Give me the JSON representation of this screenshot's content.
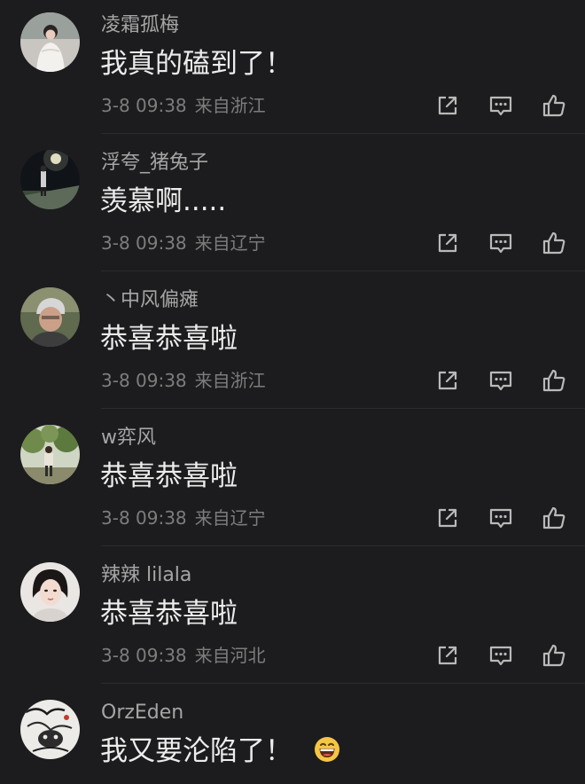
{
  "colors": {
    "background": "#1c1c1e",
    "username": "#a5a5a5",
    "comment_text": "#ececec",
    "meta": "#7d7d7d",
    "icon": "#b9b9b9",
    "divider": "#2c2c2e"
  },
  "comments": [
    {
      "username": "凌霜孤梅",
      "text": "我真的磕到了！",
      "time": "3-8 09:38",
      "location": "来自浙江",
      "avatar_icon": "avatar-woman-white-dress"
    },
    {
      "username": "浮夸_猪兔子",
      "text": "羡慕啊.....",
      "time": "3-8 09:38",
      "location": "来自辽宁",
      "avatar_icon": "avatar-night-street"
    },
    {
      "username": "丶中风偏瘫",
      "text": "恭喜恭喜啦",
      "time": "3-8 09:38",
      "location": "来自浙江",
      "avatar_icon": "avatar-man-portrait"
    },
    {
      "username": "w弈风",
      "text": "恭喜恭喜啦",
      "time": "3-8 09:38",
      "location": "来自辽宁",
      "avatar_icon": "avatar-person-trees"
    },
    {
      "username": "辣辣 lilala",
      "text": "恭喜恭喜啦",
      "time": "3-8 09:38",
      "location": "来自河北",
      "avatar_icon": "avatar-woman-portrait"
    },
    {
      "username": "OrzEden",
      "text": "我又要沦陷了！",
      "time": "",
      "location": "",
      "avatar_icon": "avatar-ink-drawing",
      "emoji_icon": "grinning-face-emoji"
    }
  ]
}
